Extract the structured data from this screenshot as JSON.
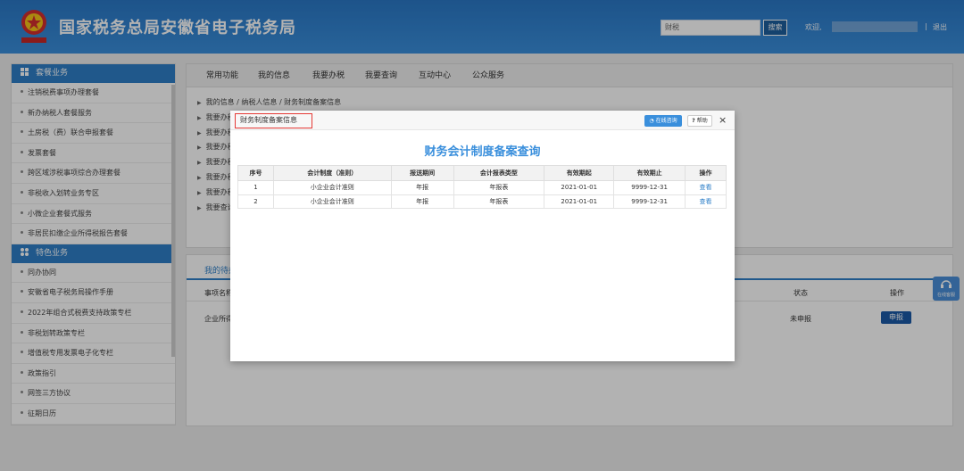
{
  "header": {
    "title": "国家税务总局安徽省电子税务局",
    "search_placeholder": "财税",
    "search_button": "搜索",
    "welcome": "欢迎,",
    "separator": "|",
    "logout": "退出"
  },
  "sidebar": {
    "section1": "套餐业务",
    "section1_items": [
      "注销税费事项办理套餐",
      "新办纳税人套餐服务",
      "土房税（费）联合申报套餐",
      "发票套餐",
      "跨区域涉税事项综合办理套餐",
      "非税收入划转业务专区",
      "小微企业套餐式服务",
      "非居民扣缴企业所得税报告套餐"
    ],
    "section2": "特色业务",
    "section2_items": [
      "同办协同",
      "安徽省电子税务局操作手册",
      "2022年组合式税费支持政策专栏",
      "非税划转政策专栏",
      "增值税专用发票电子化专栏",
      "政策指引",
      "网签三方协议",
      "征期日历"
    ]
  },
  "main": {
    "tabs": [
      "常用功能",
      "我的信息",
      "我要办税",
      "我要查询",
      "互动中心",
      "公众服务"
    ],
    "links": [
      "我的信息 / 纳税人信息 / 财务制度备案信息",
      "我要办税",
      "我要办税",
      "我要办税",
      "我要办税",
      "我要办税",
      "我要办税",
      "我要查询"
    ]
  },
  "todo": {
    "tab_label": "我的待办",
    "headers": [
      "事项名称",
      "状态",
      "操作"
    ],
    "row_name": "企业所得",
    "row_status": "未申报",
    "row_action": "申报"
  },
  "float_service": {
    "label": "在线客服"
  },
  "modal": {
    "title": "财务制度备案信息",
    "consult_button": "在线咨询",
    "help_button": "帮助",
    "close_symbol": "×",
    "heading": "财务会计制度备案查询",
    "columns": [
      "序号",
      "会计制度（准则）",
      "报送期间",
      "会计报表类型",
      "有效期起",
      "有效期止",
      "操作"
    ],
    "rows": [
      [
        "1",
        "小企业会计准则",
        "年报",
        "年报表",
        "2021-01-01",
        "9999-12-31",
        "查看"
      ],
      [
        "2",
        "小企业会计准则",
        "年报",
        "年报表",
        "2021-01-01",
        "9999-12-31",
        "查看"
      ]
    ]
  },
  "colors": {
    "header_blue": "#3a8fdc",
    "sidebar_head": "#2e7fc8",
    "highlight_red": "#e53935",
    "action_blue": "#1a5aa6"
  },
  "icons": [
    "tax-emblem-icon",
    "grid-icon",
    "chevron-right-icon",
    "headset-icon",
    "close-icon",
    "question-icon"
  ]
}
